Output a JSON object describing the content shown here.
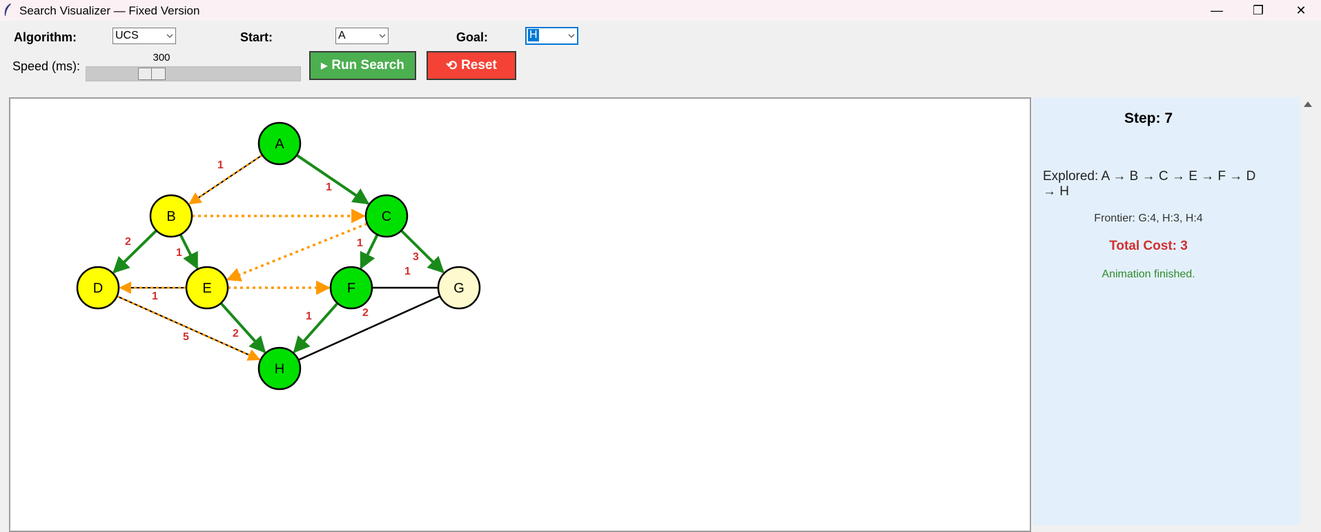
{
  "window": {
    "title": "Search Visualizer — Fixed Version",
    "min": "—",
    "max": "❐",
    "close": "✕"
  },
  "controls": {
    "algorithm_label": "Algorithm:",
    "algorithm_value": "UCS",
    "start_label": "Start:",
    "start_value": "A",
    "goal_label": "Goal:",
    "goal_value": "H",
    "speed_label": "Speed (ms):",
    "speed_value": "300",
    "speed_fraction": 0.3,
    "run_icon": "▶",
    "run_label": "Run Search",
    "reset_icon": "⟲",
    "reset_label": "Reset"
  },
  "colors": {
    "visited": "#00e000",
    "frontier": "#ffff00",
    "goal_pending": "#fffacd",
    "tree_edge": "#1a8a1a",
    "frontier_edge": "#ff9900",
    "plain_edge": "#000000",
    "weight": "#d32f2f"
  },
  "graph": {
    "nodes": [
      {
        "id": "A",
        "state": "visited"
      },
      {
        "id": "B",
        "state": "frontier"
      },
      {
        "id": "C",
        "state": "visited"
      },
      {
        "id": "D",
        "state": "frontier"
      },
      {
        "id": "E",
        "state": "frontier"
      },
      {
        "id": "F",
        "state": "visited"
      },
      {
        "id": "G",
        "state": "goal_pending"
      },
      {
        "id": "H",
        "state": "visited"
      }
    ],
    "edges": [
      {
        "from": "A",
        "to": "B",
        "weight": "1",
        "style": "both"
      },
      {
        "from": "A",
        "to": "C",
        "weight": "1",
        "style": "tree"
      },
      {
        "from": "B",
        "to": "D",
        "weight": "2",
        "style": "tree"
      },
      {
        "from": "B",
        "to": "E",
        "weight": "1",
        "style": "tree"
      },
      {
        "from": "B",
        "to": "C",
        "weight": "",
        "style": "frontier"
      },
      {
        "from": "C",
        "to": "E",
        "weight": "",
        "style": "frontier"
      },
      {
        "from": "C",
        "to": "F",
        "weight": "1",
        "style": "tree"
      },
      {
        "from": "C",
        "to": "G",
        "weight": "3",
        "style": "tree"
      },
      {
        "from": "E",
        "to": "D",
        "weight": "1",
        "style": "both"
      },
      {
        "from": "E",
        "to": "F",
        "weight": "",
        "style": "frontier"
      },
      {
        "from": "E",
        "to": "H",
        "weight": "2",
        "style": "tree"
      },
      {
        "from": "F",
        "to": "G",
        "weight": "1",
        "style": "plain"
      },
      {
        "from": "F",
        "to": "H",
        "weight": "1",
        "style": "tree"
      },
      {
        "from": "G",
        "to": "H",
        "weight": "2",
        "style": "plain"
      },
      {
        "from": "D",
        "to": "H",
        "weight": "5",
        "style": "both"
      }
    ]
  },
  "panel": {
    "step": "Step: 7",
    "explored": "Explored: A → B → C → E → F → D → H",
    "frontier": "Frontier: G:4, H:3, H:4",
    "total_cost": "Total Cost: 3",
    "status": "Animation finished."
  }
}
